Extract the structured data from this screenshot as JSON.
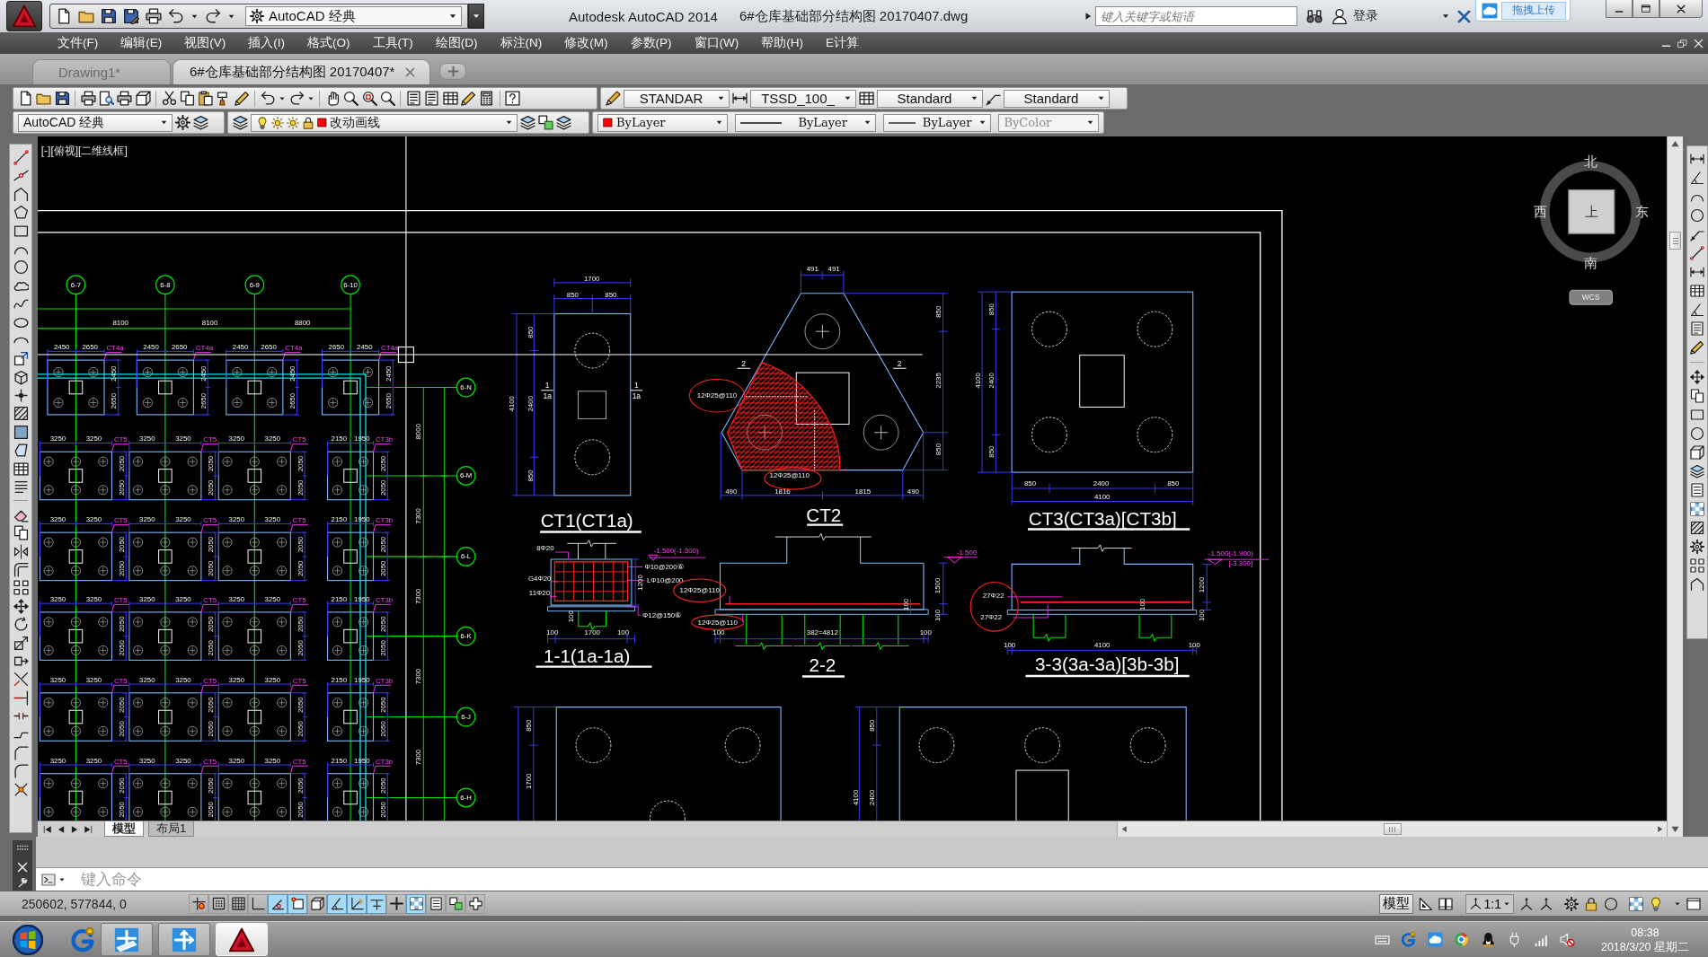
{
  "title_bar": {
    "workspace": "AutoCAD 经典",
    "app_title": "Autodesk AutoCAD 2014",
    "file_title": "6#仓库基础部分结构图 20170407.dwg",
    "search": {
      "placeholder": "键入关键字或短语"
    },
    "login": "登录",
    "upload_widget": "拖拽上传"
  },
  "menu": [
    "文件(F)",
    "编辑(E)",
    "视图(V)",
    "插入(I)",
    "格式(O)",
    "工具(T)",
    "绘图(D)",
    "标注(N)",
    "修改(M)",
    "参数(P)",
    "窗口(W)",
    "帮助(H)",
    "E计算"
  ],
  "doc_tabs": [
    {
      "label": "Drawing1*",
      "selected": false
    },
    {
      "label": "6#仓库基础部分结构图 20170407*",
      "selected": true
    }
  ],
  "styles_toolbar": [
    "STANDAR",
    "TSSD_100_",
    "Standard",
    "Standard"
  ],
  "properties_toolbar": {
    "workspace": "AutoCAD 经典",
    "layer": "改动画线",
    "object_color": "ByLayer",
    "linetype": "ByLayer",
    "lineweight": "ByLayer",
    "plot_style": {
      "value": "ByColor",
      "disabled": true
    }
  },
  "drawing": {
    "viewport_label": "[-][俯视][二维线框]",
    "viewcube": {
      "top": "上",
      "north": "北",
      "south": "南",
      "west": "西",
      "east": "东",
      "ucs": "WCS"
    },
    "plan": {
      "axes_top": [
        "6-7",
        "6-8",
        "6-9",
        "6-10"
      ],
      "spans": [
        "8100",
        "8100",
        "8800"
      ],
      "axes_right": [
        "6-N",
        "6-M",
        "6-L",
        "6-K",
        "6-J",
        "6-H"
      ],
      "right_dims": [
        "8000",
        "7300",
        "7300",
        "7300",
        "7300"
      ],
      "rows": [
        {
          "caps": [
            {
              "kind": "square",
              "dims": [
                "2450",
                "2650"
              ],
              "tag": "CT4a",
              "side": [
                "2450",
                "2650"
              ]
            },
            {
              "kind": "square",
              "dims": [
                "2450",
                "2650"
              ],
              "tag": "CT4a",
              "side": [
                "2450",
                "2650"
              ]
            },
            {
              "kind": "square",
              "dims": [
                "2450",
                "2650"
              ],
              "tag": "CT4a",
              "side": [
                "2450",
                "2650"
              ]
            },
            {
              "kind": "square",
              "dims": [
                "2650",
                "2450"
              ],
              "tag": "CT4a",
              "side": [
                "2450",
                "2650"
              ]
            }
          ]
        },
        {
          "caps": [
            {
              "kind": "wide",
              "dims": [
                "3250",
                "3250"
              ],
              "tag": "CT5",
              "side": [
                "2050",
                "2050"
              ]
            },
            {
              "kind": "wide",
              "dims": [
                "3250",
                "3250"
              ],
              "tag": "CT5",
              "side": [
                "2050",
                "2050"
              ]
            },
            {
              "kind": "wide",
              "dims": [
                "3250",
                "3250"
              ],
              "tag": "CT5",
              "side": [
                "2050",
                "2050"
              ]
            },
            {
              "kind": "narrow",
              "dims": [
                "2150",
                "1950"
              ],
              "tag": "CT3b",
              "side": [
                "2050",
                "2050"
              ]
            }
          ]
        },
        {
          "caps": [
            {
              "kind": "wide",
              "dims": [
                "3250",
                "3250"
              ],
              "tag": "CT5",
              "side": [
                "2050",
                "2050"
              ]
            },
            {
              "kind": "wide",
              "dims": [
                "3250",
                "3250"
              ],
              "tag": "CT5",
              "side": [
                "2050",
                "2050"
              ]
            },
            {
              "kind": "wide",
              "dims": [
                "3250",
                "3250"
              ],
              "tag": "CT5",
              "side": [
                "2050",
                "2050"
              ]
            },
            {
              "kind": "narrow",
              "dims": [
                "2150",
                "1950"
              ],
              "tag": "CT3b",
              "side": [
                "2050",
                "2050"
              ]
            }
          ]
        },
        {
          "caps": [
            {
              "kind": "wide",
              "dims": [
                "3250",
                "3250"
              ],
              "tag": "CT5",
              "side": [
                "2050",
                "2050"
              ]
            },
            {
              "kind": "wide",
              "dims": [
                "3250",
                "3250"
              ],
              "tag": "CT5",
              "side": [
                "2050",
                "2050"
              ]
            },
            {
              "kind": "wide",
              "dims": [
                "3250",
                "3250"
              ],
              "tag": "CT5",
              "side": [
                "2050",
                "2050"
              ]
            },
            {
              "kind": "narrow",
              "dims": [
                "2150",
                "1950"
              ],
              "tag": "CT3b",
              "side": [
                "2050",
                "2050"
              ]
            }
          ]
        },
        {
          "caps": [
            {
              "kind": "wide",
              "dims": [
                "3250",
                "3250"
              ],
              "tag": "CT5",
              "side": [
                "2050",
                "2050"
              ]
            },
            {
              "kind": "wide",
              "dims": [
                "3250",
                "3250"
              ],
              "tag": "CT5",
              "side": [
                "2050",
                "2050"
              ]
            },
            {
              "kind": "wide",
              "dims": [
                "3250",
                "3250"
              ],
              "tag": "CT5",
              "side": [
                "2050",
                "2050"
              ]
            },
            {
              "kind": "narrow",
              "dims": [
                "2150",
                "1950"
              ],
              "tag": "CT3b",
              "side": [
                "2050",
                "2050"
              ]
            }
          ]
        },
        {
          "caps": [
            {
              "kind": "wide",
              "dims": [
                "3250",
                "3250"
              ],
              "tag": "CT5",
              "side": [
                "2050",
                "2050"
              ]
            },
            {
              "kind": "wide",
              "dims": [
                "3250",
                "3250"
              ],
              "tag": "CT5",
              "side": [
                "2050",
                "2050"
              ]
            },
            {
              "kind": "wide",
              "dims": [
                "3250",
                "3250"
              ],
              "tag": "CT5",
              "side": [
                "2050",
                "2050"
              ]
            },
            {
              "kind": "narrow",
              "dims": [
                "2150",
                "1950"
              ],
              "tag": "CT3b",
              "side": [
                "2050",
                "2050"
              ]
            }
          ]
        }
      ]
    },
    "details": {
      "ct1": {
        "title": "CT1(CT1a)",
        "dims": [
          "1700",
          "850",
          "850",
          "4100",
          "850",
          "2400",
          "850"
        ],
        "section_marks": [
          "1",
          "1a",
          "1",
          "1a"
        ]
      },
      "ct2": {
        "title": "CT2",
        "dims": [
          "491",
          "491",
          "850",
          "2235",
          "850",
          "490",
          "1816",
          "1815",
          "490"
        ],
        "rebar_notes": [
          "12Φ25@110",
          "12Φ25@110"
        ],
        "section_marks": [
          "2",
          "2"
        ]
      },
      "ct3": {
        "title": "CT3(CT3a)[CT3b]",
        "dims": [
          "4100",
          "850",
          "2400",
          "850",
          "850",
          "2400",
          "850",
          "4100"
        ]
      },
      "section_1": {
        "title": "1-1(1a-1a)",
        "elevations": [
          "-1.500(-1.300)"
        ],
        "rebar_notes": [
          "8Φ20",
          "Φ10@200⑥",
          "G4Φ20",
          "LΦ10@200",
          "11Φ20",
          "Φ12@150⑥"
        ],
        "dims": [
          "1200",
          "100",
          "100",
          "1700",
          "100"
        ]
      },
      "section_2": {
        "title": "2-2",
        "elevations": [
          "-1.500"
        ],
        "rebar_notes": [
          "12Φ25@110",
          "12Φ25@110"
        ],
        "dims": [
          "1500",
          "100",
          "100",
          "100",
          "382=4812",
          "100"
        ]
      },
      "section_3": {
        "title": "3-3(3a-3a)[3b-3b]",
        "elevations": [
          "-1.500(-1.900)",
          "[-3.300]"
        ],
        "rebar_notes": [
          "27Φ22",
          "27Φ22"
        ],
        "dims": [
          "1200",
          "100",
          "100",
          "100",
          "4100",
          "100"
        ]
      },
      "partial_plans": [
        {
          "dims": [
            "850",
            "1700"
          ]
        },
        {
          "dims": [
            "850",
            "4100",
            "2400"
          ]
        }
      ]
    }
  },
  "layout_tabs": [
    {
      "label": "模型",
      "selected": true
    },
    {
      "label": "布局1",
      "selected": false
    }
  ],
  "command": {
    "placeholder": "键入命令"
  },
  "status_bar": {
    "coordinates": "250602, 577844, 0",
    "toggles": [
      {
        "on": false
      },
      {
        "on": false
      },
      {
        "on": false
      },
      {
        "on": false
      },
      {
        "on": true
      },
      {
        "on": true
      },
      {
        "on": false
      },
      {
        "on": true
      },
      {
        "on": true
      },
      {
        "on": true
      },
      {
        "on": false
      },
      {
        "on": true
      },
      {
        "on": false
      },
      {
        "on": false
      },
      {
        "on": false
      }
    ],
    "model": "模型",
    "annotation_scale": "1:1"
  },
  "taskbar": {
    "apps": [
      {
        "selected": false
      },
      {
        "selected": false
      },
      {
        "selected": true
      }
    ],
    "time": "08:38",
    "date": "2018/3/20 星期二"
  }
}
